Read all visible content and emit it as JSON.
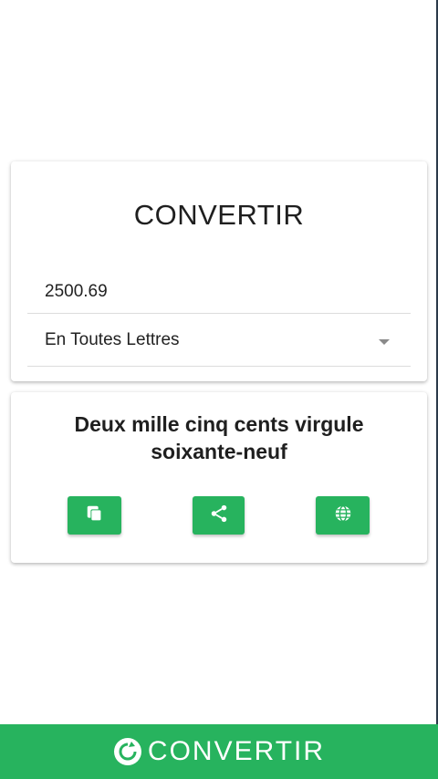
{
  "converter": {
    "title": "CONVERTIR",
    "number_value": "2500.69",
    "mode_selected": "En Toutes Lettres"
  },
  "result": {
    "text_line1": "Deux mille cinq cents virgule",
    "text_line2": "soixante-neuf"
  },
  "actions": {
    "copy_icon": "copy-icon",
    "share_icon": "share-icon",
    "web_icon": "globe-icon"
  },
  "bottom_bar": {
    "label": "CONVERTIR",
    "icon": "refresh-icon"
  },
  "colors": {
    "accent": "#27b35e",
    "background": "#ffffff",
    "text": "#1f1f1f"
  }
}
